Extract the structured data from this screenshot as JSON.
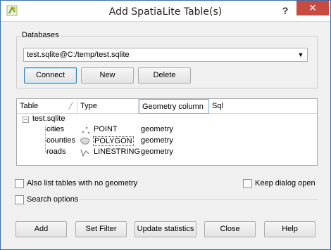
{
  "window": {
    "title": "Add SpatiaLite Table(s)",
    "help_glyph": "?",
    "close_glyph": "✕",
    "icon": "qgis-icon"
  },
  "databases": {
    "group_label": "Databases",
    "selected_db": "test.sqlite@C:/temp/test.sqlite",
    "connect_label": "Connect",
    "new_label": "New",
    "delete_label": "Delete"
  },
  "table": {
    "headers": [
      "Table",
      "Type",
      "Geometry column",
      "Sql"
    ],
    "root": "test.sqlite",
    "expander_glyph": "−",
    "rows": [
      {
        "name": "cities",
        "type": "POINT",
        "geometry": "geometry",
        "icon": "point-icon"
      },
      {
        "name": "counties",
        "type": "POLYGON",
        "geometry": "geometry",
        "icon": "polygon-icon"
      },
      {
        "name": "roads",
        "type": "LINESTRING",
        "geometry": "geometry",
        "icon": "line-icon"
      }
    ]
  },
  "options": {
    "list_no_geometry": "Also list tables with no geometry",
    "keep_dialog_open": "Keep dialog open",
    "search_options": "Search options"
  },
  "buttons": {
    "add": "Add",
    "set_filter": "Set Filter",
    "update_statistics": "Update statistics",
    "close": "Close",
    "help": "Help"
  },
  "colors": {
    "title_close_bg": "#c74b41",
    "focus_border": "#3c7fb1"
  }
}
